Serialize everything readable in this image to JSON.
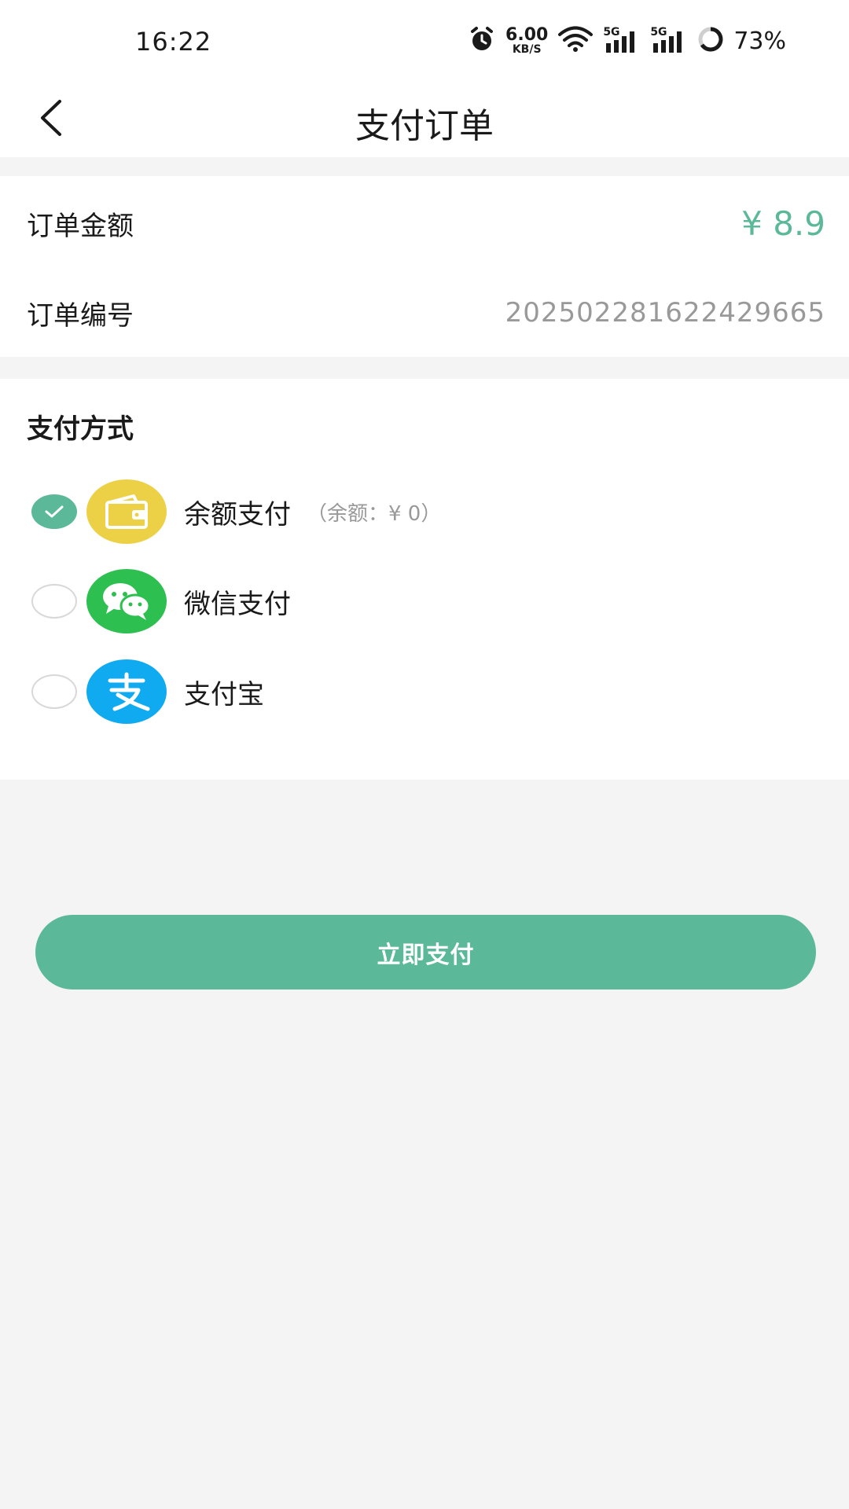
{
  "status_bar": {
    "time": "16:22",
    "net_speed_value": "6.00",
    "net_speed_unit": "KB/S",
    "sim1_label": "5G",
    "sim2_label": "5G",
    "battery_percent": "73%",
    "icons": [
      "alarm-icon",
      "wifi-icon",
      "signal-icon",
      "signal-icon",
      "battery-ring-icon"
    ]
  },
  "nav": {
    "title": "支付订单",
    "back_icon": "chevron-left-icon"
  },
  "order": {
    "amount_label": "订单金额",
    "amount_value": "¥ 8.9",
    "number_label": "订单编号",
    "number_value": "2025022816224​29665"
  },
  "payment": {
    "section_title": "支付方式",
    "methods": [
      {
        "label": "余额支付",
        "note": "（余额：¥ 0）",
        "selected": true,
        "icon": "wallet-icon"
      },
      {
        "label": "微信支付",
        "note": "",
        "selected": false,
        "icon": "wechat-icon"
      },
      {
        "label": "支付宝",
        "note": "",
        "selected": false,
        "icon": "alipay-icon"
      }
    ]
  },
  "actions": {
    "pay_now_label": "立即支付"
  },
  "colors": {
    "accent": "#5bb99a",
    "wallet": "#ecd147",
    "wechat": "#2dbf4f",
    "alipay": "#10aaf0",
    "background": "#f4f4f4"
  }
}
